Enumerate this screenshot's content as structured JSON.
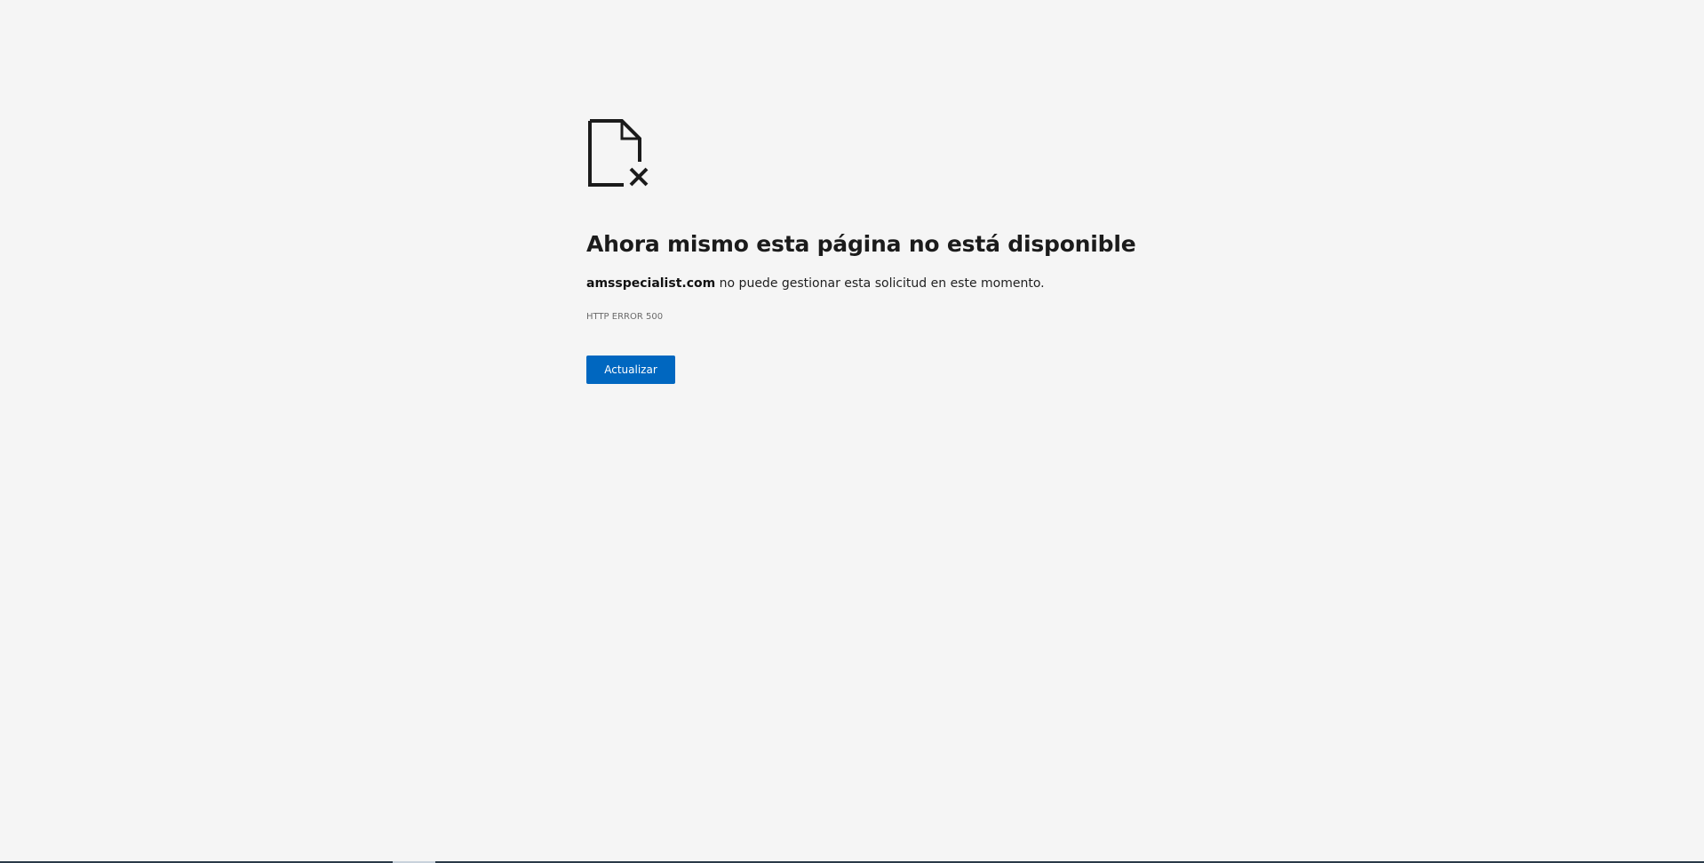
{
  "icon": "document-error-icon",
  "title": "Ahora mismo esta página no está disponible",
  "description": {
    "host": "amsspecialist.com",
    "text": " no puede gestionar esta solicitud en este momento."
  },
  "error_code": "HTTP ERROR 500",
  "reload_button_label": "Actualizar",
  "colors": {
    "background": "#f5f5f5",
    "button": "#0067c0",
    "title": "#1b1b1b",
    "code": "#6a6a6a"
  }
}
